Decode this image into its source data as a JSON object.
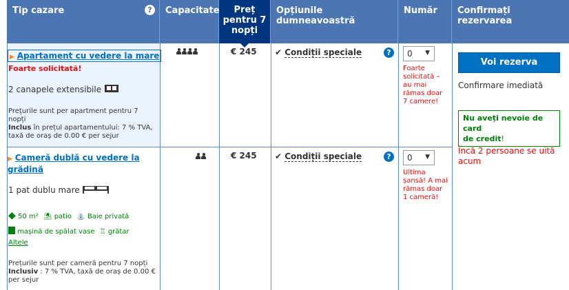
{
  "header": {
    "col_type": "Tip cazare",
    "col_capacity": "Capacitate",
    "col_price_l1": "Preț",
    "col_price_l2": "pentru 7",
    "col_price_l3": "nopți",
    "col_options": "Opțiunile dumneavoastră",
    "col_number": "Număr",
    "col_confirm": "Confirmați rezervarea"
  },
  "rooms": [
    {
      "name": "Apartament cu vedere la mare",
      "badge": "Foarte solicitată!",
      "bed": "2 canapele extensibile",
      "capacity": 4,
      "price": "€ 245",
      "condition": "Condiții speciale",
      "qty": "0",
      "note_l1": "Foarte",
      "note_l2": "solicitată –",
      "note_l3": "au mai",
      "note_l4": "rămas doar",
      "note_l5": "7 camere!",
      "price_info_l1": "Prețurile sunt per apartment pentru 7",
      "price_info_l2": "nopți",
      "included_bold": "Inclus",
      "included_rest": " în prețul apartamentului: 7 % TVA,",
      "included_l2": "taxă de oraș de 0.00 € per sejur"
    },
    {
      "name_l1": "Cameră dublă cu vedere la",
      "name_l2": "grădină",
      "bed": "1 pat dublu mare",
      "capacity": 2,
      "price": "€ 245",
      "condition": "Condiții speciale",
      "qty": "0",
      "note_l1": "Ultima",
      "note_l2": "șansă! A mai",
      "note_l3": "rămas doar",
      "note_l4": "1 cameră!",
      "facilities": {
        "size": "50 m²",
        "patio": "patio",
        "bath": "Baie privată",
        "dishwasher": "mașină de spălat vase",
        "grill": "grătar"
      },
      "more_link": "Altele",
      "price_info_l1": "Prețurile sunt per cameră pentru 7 nopți",
      "included_bold": "Inclusiv",
      "included_rest": " : 7 % TVA, taxă de oraș de 0.00 €",
      "included_l2": "per sejur"
    }
  ],
  "confirm": {
    "button": "Voi rezerva",
    "instant": "Confirmare imediată",
    "no_card_l1": "Nu aveți nevoie de card",
    "no_card_l2": "de credit",
    "no_card_excl": "!",
    "watching_l1": "Încă 2 persoane se uită",
    "watching_l2": "acum"
  },
  "colors": {
    "header": "#4c76b2",
    "price_header": "#003580",
    "link": "#0071c2",
    "alert": "#e21111",
    "success": "#008009"
  }
}
